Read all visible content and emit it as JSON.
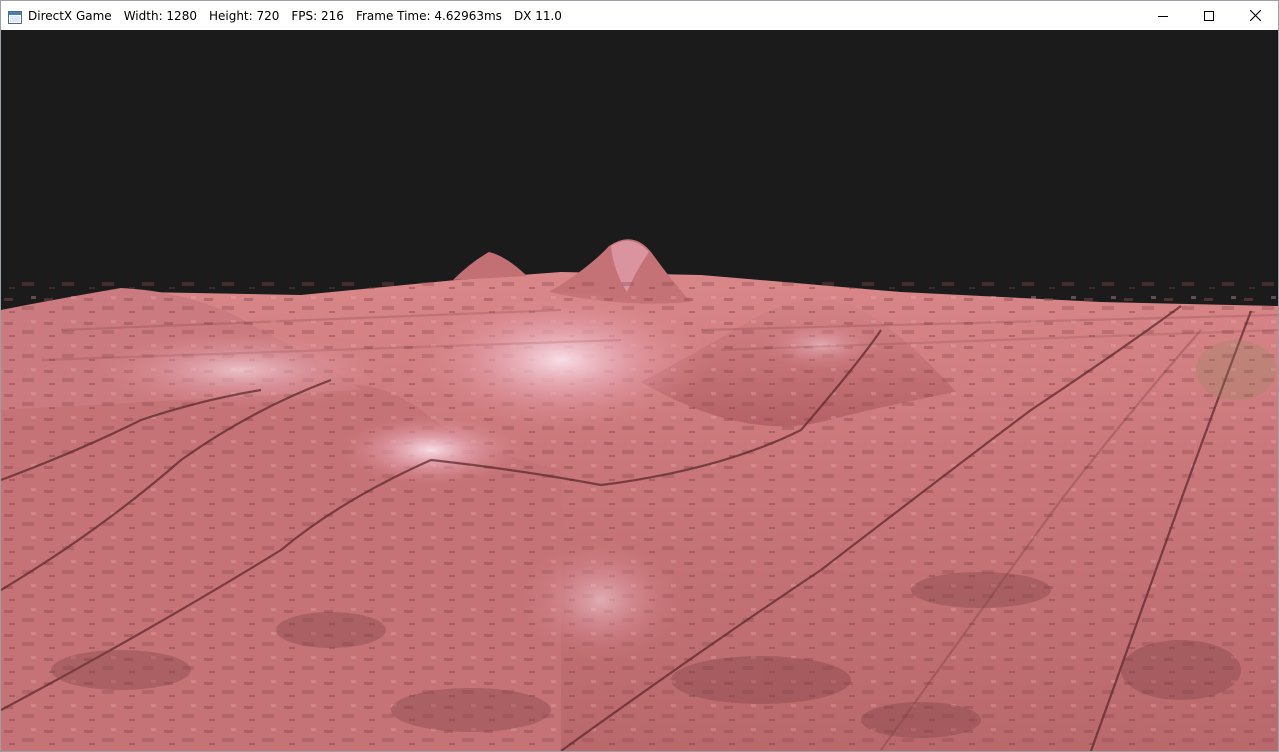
{
  "window": {
    "app_name": "DirectX Game",
    "width_label": "Width: 1280",
    "height_label": "Height: 720",
    "fps_label": "FPS: 216",
    "frame_time_label": "Frame Time: 4.62963ms",
    "api_label": "DX 11.0",
    "icon": "application-window-icon"
  },
  "caption_buttons": {
    "minimize_icon": "minimize-icon",
    "maximize_icon": "maximize-icon",
    "close_icon": "close-icon"
  },
  "scene": {
    "sky_color": "#1b1b1b",
    "terrain_color": "#c86f73",
    "terrain_highlight_color": "#f1c6d2",
    "terrain_shadow_color": "#6e3334"
  }
}
